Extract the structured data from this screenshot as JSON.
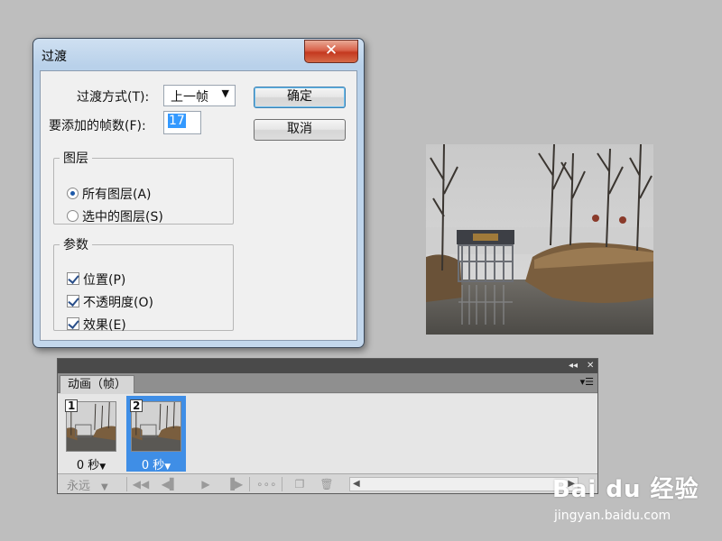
{
  "dialog": {
    "title": "过渡",
    "close_label": "✕",
    "transition_label": "过渡方式(T):",
    "transition_value": "上一帧",
    "frames_label": "要添加的帧数(F):",
    "frames_value": "17",
    "ok_label": "确定",
    "cancel_label": "取消",
    "layers_group": {
      "legend": "图层",
      "options": [
        {
          "label": "所有图层(A)",
          "selected": true
        },
        {
          "label": "选中的图层(S)",
          "selected": false
        }
      ]
    },
    "params_group": {
      "legend": "参数",
      "options": [
        {
          "label": "位置(P)",
          "checked": true
        },
        {
          "label": "不透明度(O)",
          "checked": true
        },
        {
          "label": "效果(E)",
          "checked": true
        }
      ]
    }
  },
  "panel": {
    "tab_label": "动画（帧）",
    "collapse_icon": "double-chevron-icon",
    "close_icon": "close-icon",
    "frames": [
      {
        "number": "1",
        "delay": "0 秒",
        "selected": false
      },
      {
        "number": "2",
        "delay": "0 秒",
        "selected": true
      }
    ],
    "loop_label": "永远",
    "selected_color": "#3f8ee6"
  },
  "watermark": {
    "brand": "Bai du 经验",
    "url": "jingyan.baidu.com"
  }
}
